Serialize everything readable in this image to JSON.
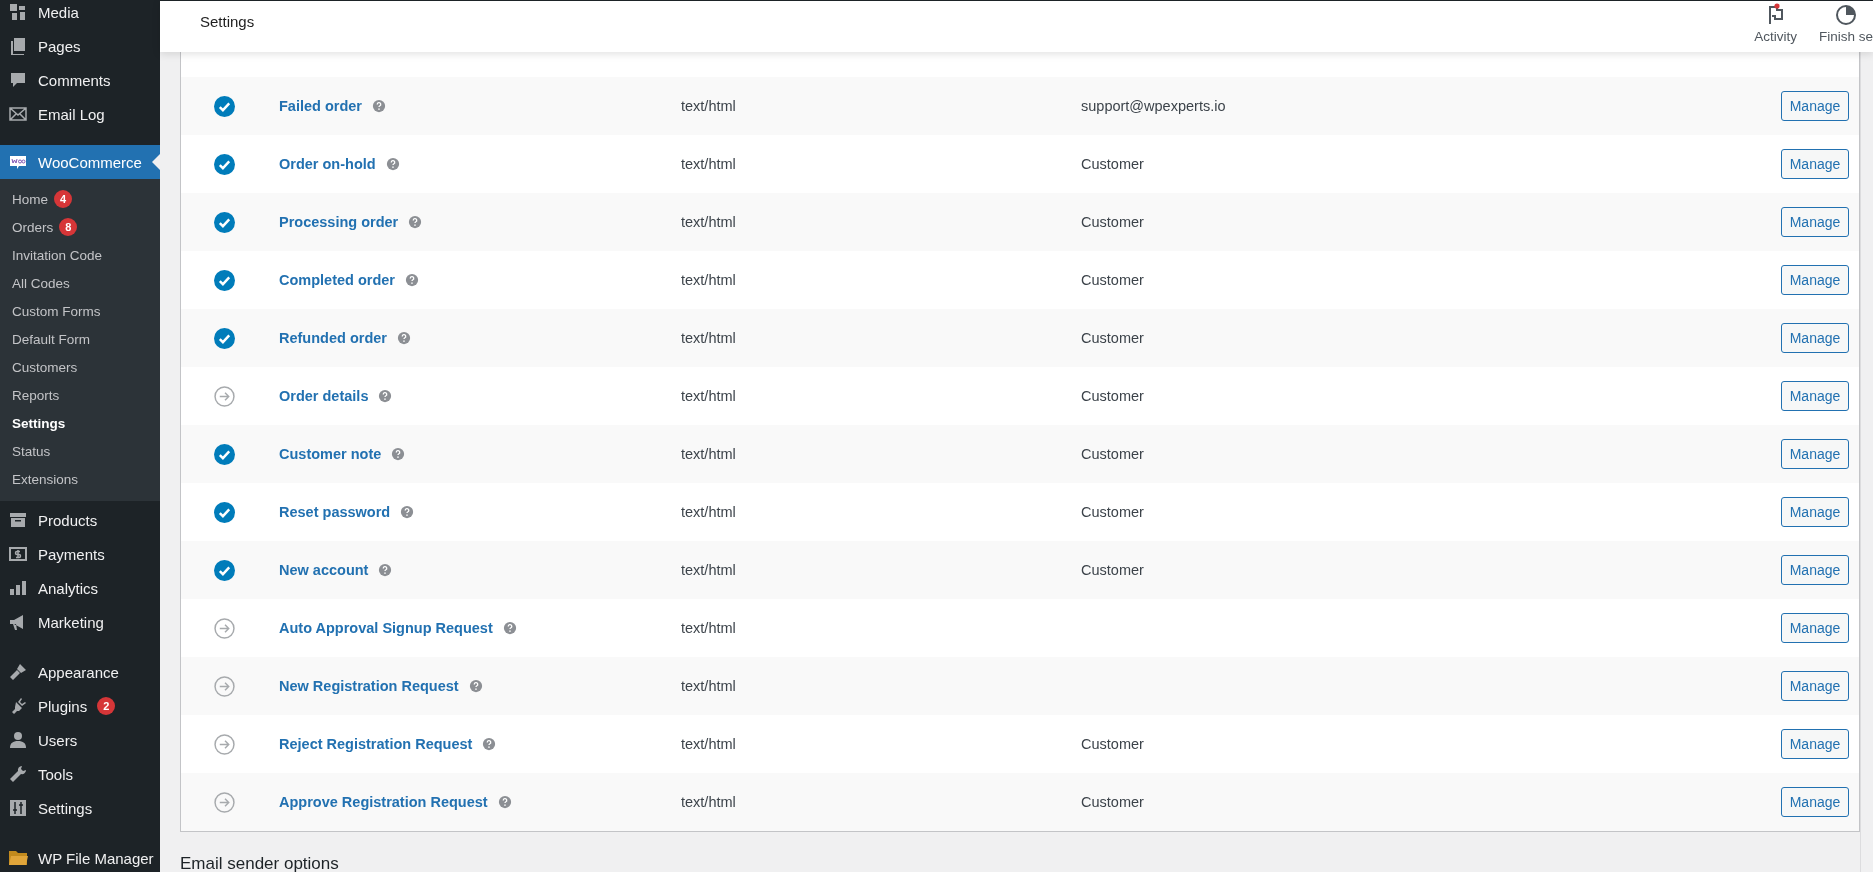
{
  "sidebar": {
    "top_items": [
      {
        "label": "Media",
        "kind": "media",
        "selected": false
      },
      {
        "label": "Pages",
        "kind": "pages",
        "selected": false
      },
      {
        "label": "Comments",
        "kind": "comments",
        "selected": false
      },
      {
        "label": "Email Log",
        "kind": "mail",
        "selected": false
      }
    ],
    "active_menu": {
      "label": "WooCommerce",
      "selected": true,
      "submenu": [
        {
          "label": "Home",
          "badge": "4",
          "selected": false
        },
        {
          "label": "Orders",
          "badge": "8",
          "selected": false
        },
        {
          "label": "Invitation Code",
          "selected": false
        },
        {
          "label": "All Codes",
          "selected": false
        },
        {
          "label": "Custom Forms",
          "selected": false
        },
        {
          "label": "Default Form",
          "selected": false
        },
        {
          "label": "Customers",
          "selected": false
        },
        {
          "label": "Reports",
          "selected": false
        },
        {
          "label": "Settings",
          "selected": true
        },
        {
          "label": "Status",
          "selected": false
        },
        {
          "label": "Extensions",
          "selected": false
        }
      ]
    },
    "groups": [
      [
        {
          "label": "Products",
          "kind": "products",
          "selected": false
        },
        {
          "label": "Payments",
          "kind": "payments",
          "selected": false
        },
        {
          "label": "Analytics",
          "kind": "analytics",
          "selected": false
        },
        {
          "label": "Marketing",
          "kind": "marketing",
          "selected": false
        }
      ],
      [
        {
          "label": "Appearance",
          "kind": "appearance",
          "selected": false
        },
        {
          "label": "Plugins",
          "kind": "plugins",
          "badge": "2",
          "selected": false
        },
        {
          "label": "Users",
          "kind": "users",
          "selected": false
        },
        {
          "label": "Tools",
          "kind": "tools",
          "selected": false
        },
        {
          "label": "Settings",
          "kind": "settings",
          "selected": false
        }
      ],
      [
        {
          "label": "WP File Manager",
          "kind": "folder",
          "selected": false
        }
      ]
    ]
  },
  "header": {
    "title": "Settings",
    "actions": [
      {
        "label": "Activity",
        "kind": "flag"
      },
      {
        "label": "Finish se",
        "kind": "progress"
      }
    ]
  },
  "emails": [
    {
      "name": "Failed order",
      "enabled": true,
      "content_type": "text/html",
      "recipient": "support@wpexperts.io",
      "action": "Manage"
    },
    {
      "name": "Order on-hold",
      "enabled": true,
      "content_type": "text/html",
      "recipient": "Customer",
      "action": "Manage"
    },
    {
      "name": "Processing order",
      "enabled": true,
      "content_type": "text/html",
      "recipient": "Customer",
      "action": "Manage"
    },
    {
      "name": "Completed order",
      "enabled": true,
      "content_type": "text/html",
      "recipient": "Customer",
      "action": "Manage"
    },
    {
      "name": "Refunded order",
      "enabled": true,
      "content_type": "text/html",
      "recipient": "Customer",
      "action": "Manage"
    },
    {
      "name": "Order details",
      "enabled": false,
      "content_type": "text/html",
      "recipient": "Customer",
      "action": "Manage"
    },
    {
      "name": "Customer note",
      "enabled": true,
      "content_type": "text/html",
      "recipient": "Customer",
      "action": "Manage"
    },
    {
      "name": "Reset password",
      "enabled": true,
      "content_type": "text/html",
      "recipient": "Customer",
      "action": "Manage"
    },
    {
      "name": "New account",
      "enabled": true,
      "content_type": "text/html",
      "recipient": "Customer",
      "action": "Manage"
    },
    {
      "name": "Auto Approval Signup Request",
      "enabled": false,
      "content_type": "text/html",
      "action": "Manage"
    },
    {
      "name": "New Registration Request",
      "enabled": false,
      "content_type": "text/html",
      "action": "Manage"
    },
    {
      "name": "Reject Registration Request",
      "enabled": false,
      "content_type": "text/html",
      "recipient": "Customer",
      "action": "Manage"
    },
    {
      "name": "Approve Registration Request",
      "enabled": false,
      "content_type": "text/html",
      "recipient": "Customer",
      "action": "Manage"
    }
  ],
  "section_heading": "Email sender options"
}
